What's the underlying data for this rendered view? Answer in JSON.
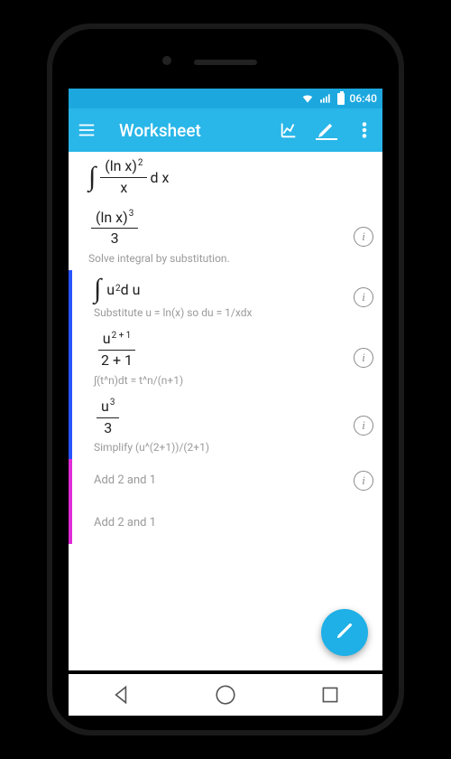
{
  "statusbar": {
    "time": "06:40"
  },
  "actionbar": {
    "title": "Worksheet"
  },
  "rows": {
    "r0": {
      "hint": ""
    },
    "r1": {
      "hint": "Solve integral by substitution."
    },
    "r2": {
      "hint": "Substitute u = ln(x) so du = 1/xdx"
    },
    "r3": {
      "expTop": "2 + 1",
      "den": "2 + 1",
      "hint": "∫(t^n)dt = t^n/(n+1)"
    },
    "r4": {
      "expTop": "3",
      "den": "3",
      "hint": "Simplify (u^(2+1))/(2+1)"
    },
    "r5": {
      "text": "Add 2 and 1"
    },
    "r6": {
      "text": "Add 2 and 1"
    }
  },
  "sym": {
    "u": "u",
    "lnx": "(ln x)",
    "x": "x",
    "d": "d",
    "two": "2",
    "three": "3"
  }
}
